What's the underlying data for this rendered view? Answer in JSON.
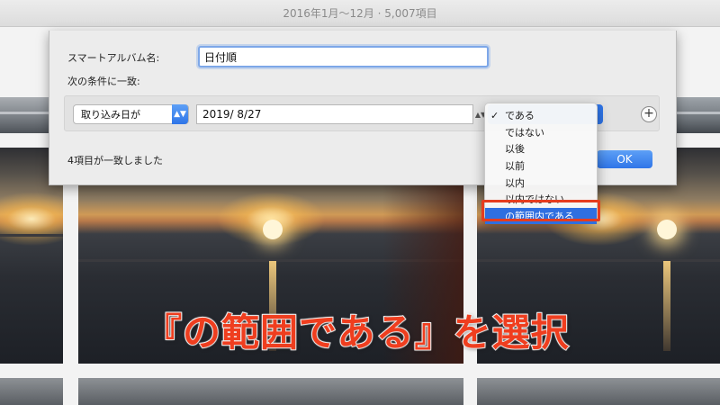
{
  "window": {
    "title": "2016年1月〜12月 · 5,007項目"
  },
  "sheet": {
    "album_name_label": "スマートアルバム名:",
    "album_name_value": "日付順",
    "criteria_label": "次の条件に一致:",
    "condition": {
      "field_value": "取り込み日が",
      "date_value": "2019/ 8/27"
    },
    "add_rule_symbol": "+",
    "match_count": "4項目が一致しました",
    "ok_label": "OK"
  },
  "operator_menu": {
    "checked_item": "である",
    "items": [
      {
        "label": "である"
      },
      {
        "label": "ではない"
      },
      {
        "label": "以後"
      },
      {
        "label": "以前"
      },
      {
        "label": "以内"
      },
      {
        "label": "以内ではない"
      },
      {
        "label": "の範囲内である"
      }
    ],
    "selected_index": 6,
    "highlight_color": "#e63c1e",
    "accent_color": "#2f6fe0"
  },
  "caption": {
    "text": "『の範囲である』を選択",
    "color": "#ef3e1f"
  },
  "icons": {
    "checkmark": "✓",
    "popup_arrows": "▲▼",
    "stepper_arrows": "▲▼"
  }
}
